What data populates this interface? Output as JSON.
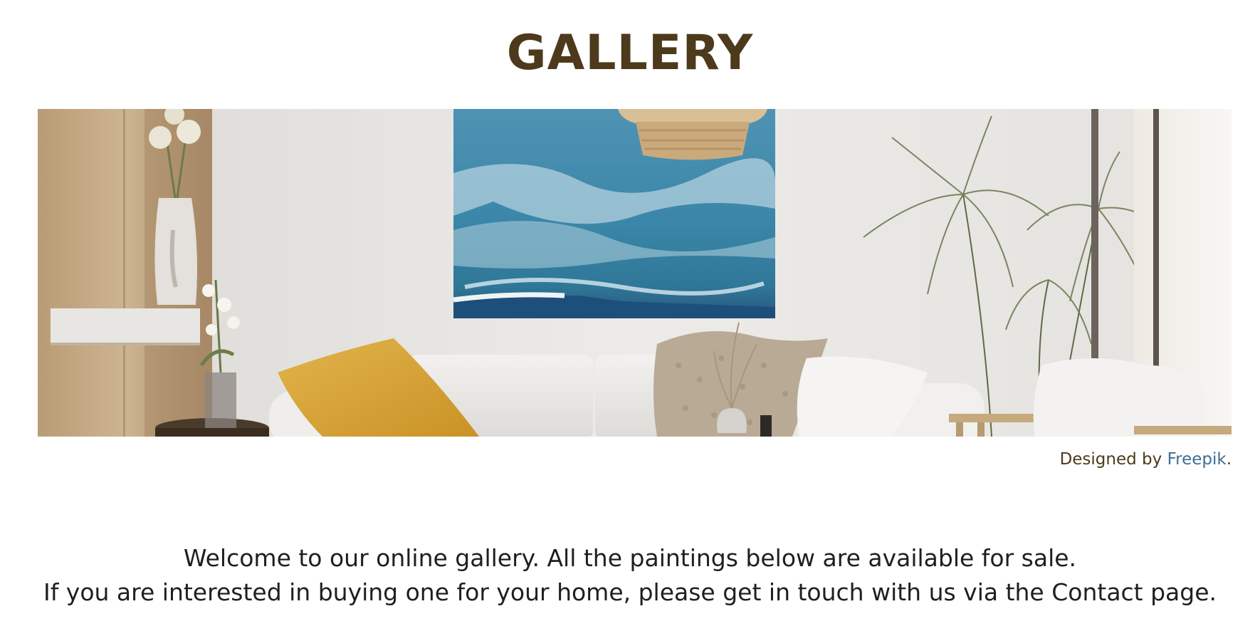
{
  "page": {
    "title": "GALLERY"
  },
  "hero": {
    "image_name": "living-room-with-painting"
  },
  "credit": {
    "prefix": "Designed by ",
    "link_text": "Freepik",
    "suffix": "."
  },
  "intro": {
    "line1": "Welcome to our online gallery. All the paintings below are available for sale.",
    "line2": "If you are interested in buying one for your home, please get in touch with us via the Contact page."
  },
  "colors": {
    "title": "#4d3a1c",
    "link": "#3f6e93",
    "body_text": "#1f1f1f"
  }
}
